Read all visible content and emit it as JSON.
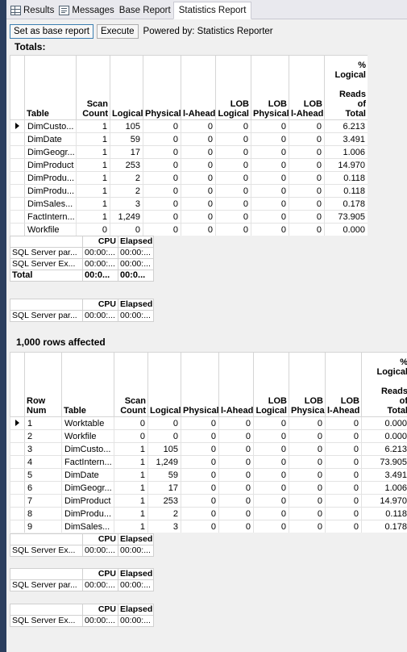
{
  "tabs": [
    {
      "label": "Results",
      "icon": "grid-icon"
    },
    {
      "label": "Messages",
      "icon": "messages-icon"
    },
    {
      "label": "Base Report"
    },
    {
      "label": "Statistics Report",
      "active": true
    }
  ],
  "toolbar": {
    "set_base_label": "Set as base report",
    "execute_label": "Execute",
    "powered_by": "Powered by: Statistics Reporter"
  },
  "totals": {
    "title": "Totals:",
    "headers": [
      "Table",
      "Scan Count",
      "Logical",
      "Physical",
      "Read-Ahead",
      "LOB Logical",
      "LOB Physical",
      "LOB Read-Ahead",
      "% Logical Reads of Total"
    ],
    "header_display": [
      "Table",
      "Scan\nCount",
      "Logical",
      "Physical",
      "l-Ahead",
      "LOB\nLogical",
      "LOB\nPhysical",
      "LOB\nl-Ahead",
      "%\nLogical\n\nReads\nof\nTotal"
    ],
    "rows": [
      [
        "DimCusto...",
        "1",
        "105",
        "0",
        "0",
        "0",
        "0",
        "0",
        "6.213"
      ],
      [
        "DimDate",
        "1",
        "59",
        "0",
        "0",
        "0",
        "0",
        "0",
        "3.491"
      ],
      [
        "DimGeogr...",
        "1",
        "17",
        "0",
        "0",
        "0",
        "0",
        "0",
        "1.006"
      ],
      [
        "DimProduct",
        "1",
        "253",
        "0",
        "0",
        "0",
        "0",
        "0",
        "14.970"
      ],
      [
        "DimProdu...",
        "1",
        "2",
        "0",
        "0",
        "0",
        "0",
        "0",
        "0.118"
      ],
      [
        "DimProdu...",
        "1",
        "2",
        "0",
        "0",
        "0",
        "0",
        "0",
        "0.118"
      ],
      [
        "DimSales...",
        "1",
        "3",
        "0",
        "0",
        "0",
        "0",
        "0",
        "0.178"
      ],
      [
        "FactIntern...",
        "1",
        "1,249",
        "0",
        "0",
        "0",
        "0",
        "0",
        "73.905"
      ],
      [
        "Workfile",
        "0",
        "0",
        "0",
        "0",
        "0",
        "0",
        "0",
        "0.000"
      ]
    ]
  },
  "cpu_totals": {
    "headers": [
      "",
      "CPU",
      "Elapsed"
    ],
    "rows": [
      [
        "SQL Server par...",
        "00:00:...",
        "00:00:..."
      ],
      [
        "SQL Server Ex...",
        "00:00:...",
        "00:00:..."
      ]
    ],
    "total": [
      "Total",
      "00:0...",
      "00:0..."
    ]
  },
  "cpu_parse_1": {
    "headers": [
      "",
      "CPU",
      "Elapsed"
    ],
    "rows": [
      [
        "SQL Server par...",
        "00:00:...",
        "00:00:..."
      ]
    ]
  },
  "rows_affected": "1,000 rows affected",
  "detail": {
    "headers": [
      "Row Num",
      "Table",
      "Scan Count",
      "Logical",
      "Physical",
      "Read-Ahead",
      "LOB Logical",
      "LOB Physical",
      "LOB Read-Ahead",
      "% Logical Reads of Total"
    ],
    "header_display": [
      "Row\nNum",
      "Table",
      "Scan\nCount",
      "Logical",
      "Physical",
      "l-Ahead",
      "LOB\nLogical",
      "LOB\nPhysical",
      "LOB\nl-Ahead",
      "%\nLogical\n\nReads\nof\nTotal"
    ],
    "rows": [
      [
        "1",
        "Worktable",
        "0",
        "0",
        "0",
        "0",
        "0",
        "0",
        "0",
        "0.000"
      ],
      [
        "2",
        "Workfile",
        "0",
        "0",
        "0",
        "0",
        "0",
        "0",
        "0",
        "0.000"
      ],
      [
        "3",
        "DimCusto...",
        "1",
        "105",
        "0",
        "0",
        "0",
        "0",
        "0",
        "6.213"
      ],
      [
        "4",
        "FactIntern...",
        "1",
        "1,249",
        "0",
        "0",
        "0",
        "0",
        "0",
        "73.905"
      ],
      [
        "5",
        "DimDate",
        "1",
        "59",
        "0",
        "0",
        "0",
        "0",
        "0",
        "3.491"
      ],
      [
        "6",
        "DimGeogr...",
        "1",
        "17",
        "0",
        "0",
        "0",
        "0",
        "0",
        "1.006"
      ],
      [
        "7",
        "DimProduct",
        "1",
        "253",
        "0",
        "0",
        "0",
        "0",
        "0",
        "14.970"
      ],
      [
        "8",
        "DimProdu...",
        "1",
        "2",
        "0",
        "0",
        "0",
        "0",
        "0",
        "0.118"
      ],
      [
        "9",
        "DimSales...",
        "1",
        "3",
        "0",
        "0",
        "0",
        "0",
        "0",
        "0.178"
      ]
    ]
  },
  "cpu_exec_1": {
    "headers": [
      "",
      "CPU",
      "Elapsed"
    ],
    "rows": [
      [
        "SQL Server Ex...",
        "00:00:...",
        "00:00:..."
      ]
    ]
  },
  "cpu_parse_2": {
    "headers": [
      "",
      "CPU",
      "Elapsed"
    ],
    "rows": [
      [
        "SQL Server par...",
        "00:00:...",
        "00:00:..."
      ]
    ]
  },
  "cpu_exec_2": {
    "headers": [
      "",
      "CPU",
      "Elapsed"
    ],
    "rows": [
      [
        "SQL Server Ex...",
        "00:00:...",
        "00:00:..."
      ]
    ]
  }
}
